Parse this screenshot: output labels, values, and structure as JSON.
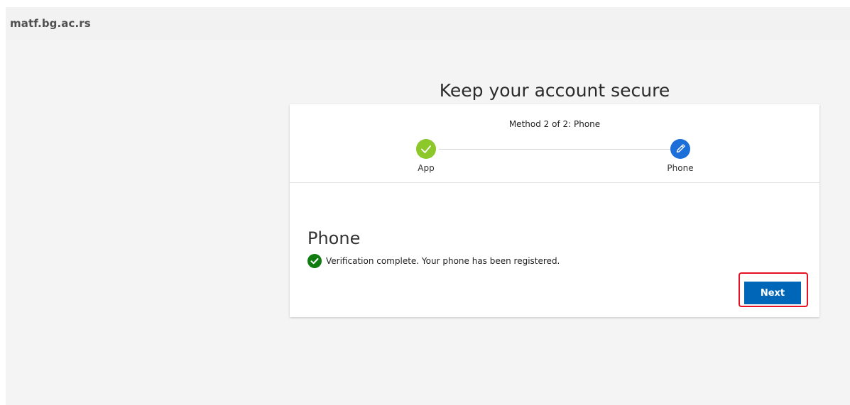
{
  "header": {
    "org_name": "matf.bg.ac.rs",
    "background": "#f2f2f2"
  },
  "page": {
    "title": "Keep your account secure"
  },
  "stepper": {
    "label": "Method 2 of 2: Phone",
    "steps": [
      {
        "label": "App",
        "state": "complete",
        "icon": "check-icon",
        "color": "#8cc82a"
      },
      {
        "label": "Phone",
        "state": "current",
        "icon": "pencil-icon",
        "color": "#1c6ed8"
      }
    ]
  },
  "section": {
    "title": "Phone",
    "status_icon": "success-check-icon",
    "status_color": "#107c10",
    "status_text": "Verification complete. Your phone has been registered."
  },
  "actions": {
    "next_label": "Next",
    "next_color": "#0067b8",
    "highlight_color": "#e81123"
  }
}
